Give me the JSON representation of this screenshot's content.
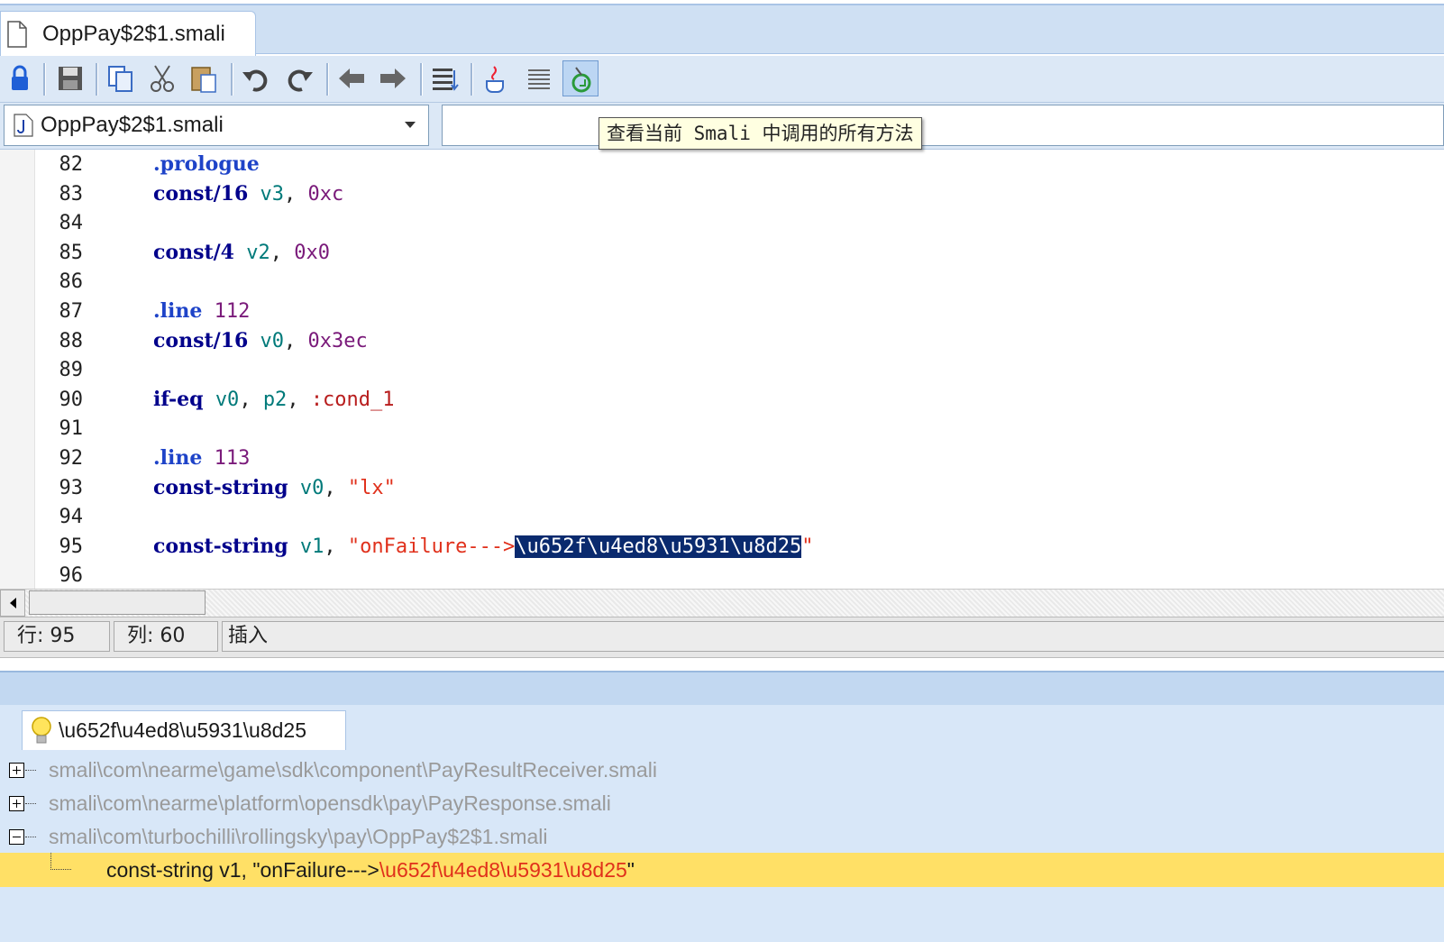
{
  "tab": {
    "title": "OppPay$2$1.smali"
  },
  "toolbar": {
    "buttons": [
      "lock-icon",
      "save-icon",
      "copy-icon",
      "cut-icon",
      "paste-icon",
      "undo-icon",
      "redo-icon",
      "back-icon",
      "forward-icon",
      "format-icon",
      "java-icon",
      "text-align-icon",
      "refresh-methods-icon"
    ]
  },
  "selector": {
    "file": "OppPay$2$1.smali",
    "method": ""
  },
  "tooltip": {
    "text": "查看当前 Smali 中调用的所有方法"
  },
  "editor": {
    "lines": [
      {
        "n": "82",
        "tokens": [
          {
            "t": ".prologue",
            "c": "dir"
          }
        ]
      },
      {
        "n": "83",
        "tokens": [
          {
            "t": "const/16",
            "c": "kw"
          },
          {
            "t": " "
          },
          {
            "t": "v3",
            "c": "reg"
          },
          {
            "t": ", ",
            "c": "pun"
          },
          {
            "t": "0xc",
            "c": "num"
          }
        ]
      },
      {
        "n": "84",
        "tokens": []
      },
      {
        "n": "85",
        "tokens": [
          {
            "t": "const/4",
            "c": "kw"
          },
          {
            "t": " "
          },
          {
            "t": "v2",
            "c": "reg"
          },
          {
            "t": ", ",
            "c": "pun"
          },
          {
            "t": "0x0",
            "c": "num"
          }
        ]
      },
      {
        "n": "86",
        "tokens": []
      },
      {
        "n": "87",
        "tokens": [
          {
            "t": ".line",
            "c": "dir"
          },
          {
            "t": " "
          },
          {
            "t": "112",
            "c": "num"
          }
        ]
      },
      {
        "n": "88",
        "tokens": [
          {
            "t": "const/16",
            "c": "kw"
          },
          {
            "t": " "
          },
          {
            "t": "v0",
            "c": "reg"
          },
          {
            "t": ", ",
            "c": "pun"
          },
          {
            "t": "0x3ec",
            "c": "num"
          }
        ]
      },
      {
        "n": "89",
        "tokens": []
      },
      {
        "n": "90",
        "tokens": [
          {
            "t": "if-eq",
            "c": "kw"
          },
          {
            "t": " "
          },
          {
            "t": "v0",
            "c": "reg"
          },
          {
            "t": ", ",
            "c": "pun"
          },
          {
            "t": "p2",
            "c": "reg"
          },
          {
            "t": ", ",
            "c": "pun"
          },
          {
            "t": ":cond_1",
            "c": "lbl"
          }
        ]
      },
      {
        "n": "91",
        "tokens": []
      },
      {
        "n": "92",
        "tokens": [
          {
            "t": ".line",
            "c": "dir"
          },
          {
            "t": " "
          },
          {
            "t": "113",
            "c": "num"
          }
        ]
      },
      {
        "n": "93",
        "tokens": [
          {
            "t": "const-string",
            "c": "kw"
          },
          {
            "t": " "
          },
          {
            "t": "v0",
            "c": "reg"
          },
          {
            "t": ", ",
            "c": "pun"
          },
          {
            "t": "\"lx\"",
            "c": "str"
          }
        ]
      },
      {
        "n": "94",
        "tokens": []
      },
      {
        "n": "95",
        "tokens": [
          {
            "t": "const-string",
            "c": "kw"
          },
          {
            "t": " "
          },
          {
            "t": "v1",
            "c": "reg"
          },
          {
            "t": ", ",
            "c": "pun"
          },
          {
            "t": "\"onFailure--->",
            "c": "str"
          },
          {
            "t": "\\u652f\\u4ed8\\u5931\\u8d25",
            "c": "sel"
          },
          {
            "t": "\"",
            "c": "str"
          }
        ]
      },
      {
        "n": "96",
        "tokens": []
      }
    ]
  },
  "status": {
    "row": "行: 95",
    "col": "列: 60",
    "mode": "插入"
  },
  "results": {
    "tab_label": "\\u652f\\u4ed8\\u5931\\u8d25",
    "files": [
      {
        "expander": "plus",
        "path": "smali\\com\\nearme\\game\\sdk\\component\\PayResultReceiver.smali"
      },
      {
        "expander": "plus",
        "path": "smali\\com\\nearme\\platform\\opensdk\\pay\\PayResponse.smali"
      },
      {
        "expander": "minus",
        "path": "smali\\com\\turbochilli\\rollingsky\\pay\\OppPay$2$1.smali"
      }
    ],
    "match": {
      "prefix": "const-string v1, \"onFailure--->",
      "highlight": "\\u652f\\u4ed8\\u5931\\u8d25",
      "suffix": "\""
    }
  }
}
